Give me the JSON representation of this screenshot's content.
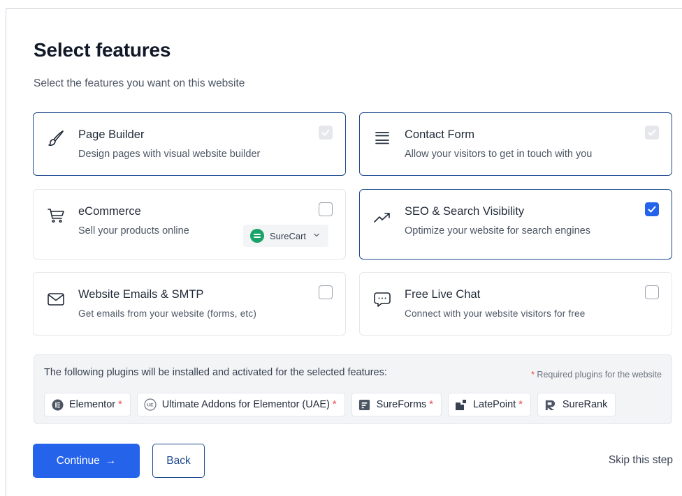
{
  "page": {
    "title": "Select features",
    "subtitle": "Select the features you want on this website"
  },
  "features": [
    {
      "name": "Page Builder",
      "description": "Design pages with visual website builder",
      "icon": "brush-icon",
      "state": "required"
    },
    {
      "name": "Contact Form",
      "description": "Allow your visitors to get in touch with you",
      "icon": "form-lines-icon",
      "state": "required"
    },
    {
      "name": "eCommerce",
      "description": "Sell your products online",
      "icon": "cart-icon",
      "state": "unchecked",
      "provider": {
        "label": "SureCart",
        "icon": "surecart-logo-icon"
      }
    },
    {
      "name": "SEO & Search Visibility",
      "description": "Optimize your website for search engines",
      "icon": "trending-up-icon",
      "state": "checked"
    },
    {
      "name": "Website Emails & SMTP",
      "description": "Get emails from your website (forms, etc)",
      "icon": "mail-icon",
      "state": "unchecked"
    },
    {
      "name": "Free Live Chat",
      "description": "Connect with your website visitors for free",
      "icon": "chat-bubble-icon",
      "state": "unchecked"
    }
  ],
  "plugins": {
    "intro": "The following plugins will be installed and activated for the selected features:",
    "required_note_star": "*",
    "required_note": "Required plugins for the website",
    "items": [
      {
        "name": "Elementor",
        "required_mark": "*",
        "icon": "elementor-logo-icon"
      },
      {
        "name": "Ultimate Addons for Elementor (UAE)",
        "required_mark": "*",
        "icon": "uae-logo-icon"
      },
      {
        "name": "SureForms",
        "required_mark": "*",
        "icon": "sureforms-logo-icon"
      },
      {
        "name": "LatePoint",
        "required_mark": "*",
        "icon": "latepoint-logo-icon"
      },
      {
        "name": "SureRank",
        "required_mark": "",
        "icon": "surerank-logo-icon"
      }
    ]
  },
  "actions": {
    "continue_label": "Continue",
    "continue_arrow": "→",
    "back_label": "Back",
    "skip_label": "Skip this step"
  },
  "colors": {
    "accent": "#2563eb",
    "selected_border": "#1e4a8f",
    "required_star": "#ef4444",
    "surecart_green": "#1aa368"
  }
}
